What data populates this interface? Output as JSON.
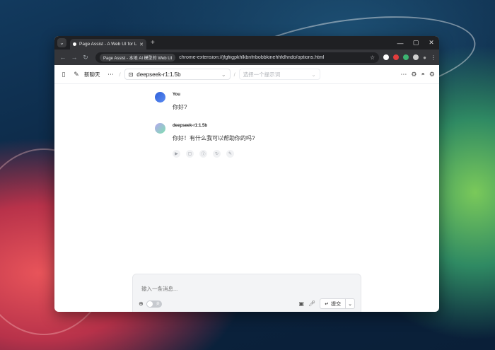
{
  "browser": {
    "tab_title": "Page Assist - A Web UI for L",
    "site_chip": "Page Assist - 本地 AI 模型的 Web UI",
    "url": "chrome-extension://jfgfiigpkhlkbnfnbobbkinehhfdhndo/options.html",
    "ext_colors": [
      "#ffffff",
      "#e23d3d",
      "#3cb371",
      "#cfcfcf"
    ]
  },
  "header": {
    "new_chat_label": "新聊天",
    "model_value": "deepseek-r1:1.5b",
    "prompt_placeholder": "选择一个提示词"
  },
  "messages": [
    {
      "sender": "You",
      "text": "你好?",
      "avatar_color": "#3b6fe0"
    },
    {
      "sender": "deepseek-r1:1.5b",
      "text": "你好！有什么我可以帮助你的吗?",
      "avatar_color": "#9ad0b0"
    }
  ],
  "composer": {
    "placeholder": "输入一条消息...",
    "toggle_label": "关",
    "submit_label": "提交"
  }
}
